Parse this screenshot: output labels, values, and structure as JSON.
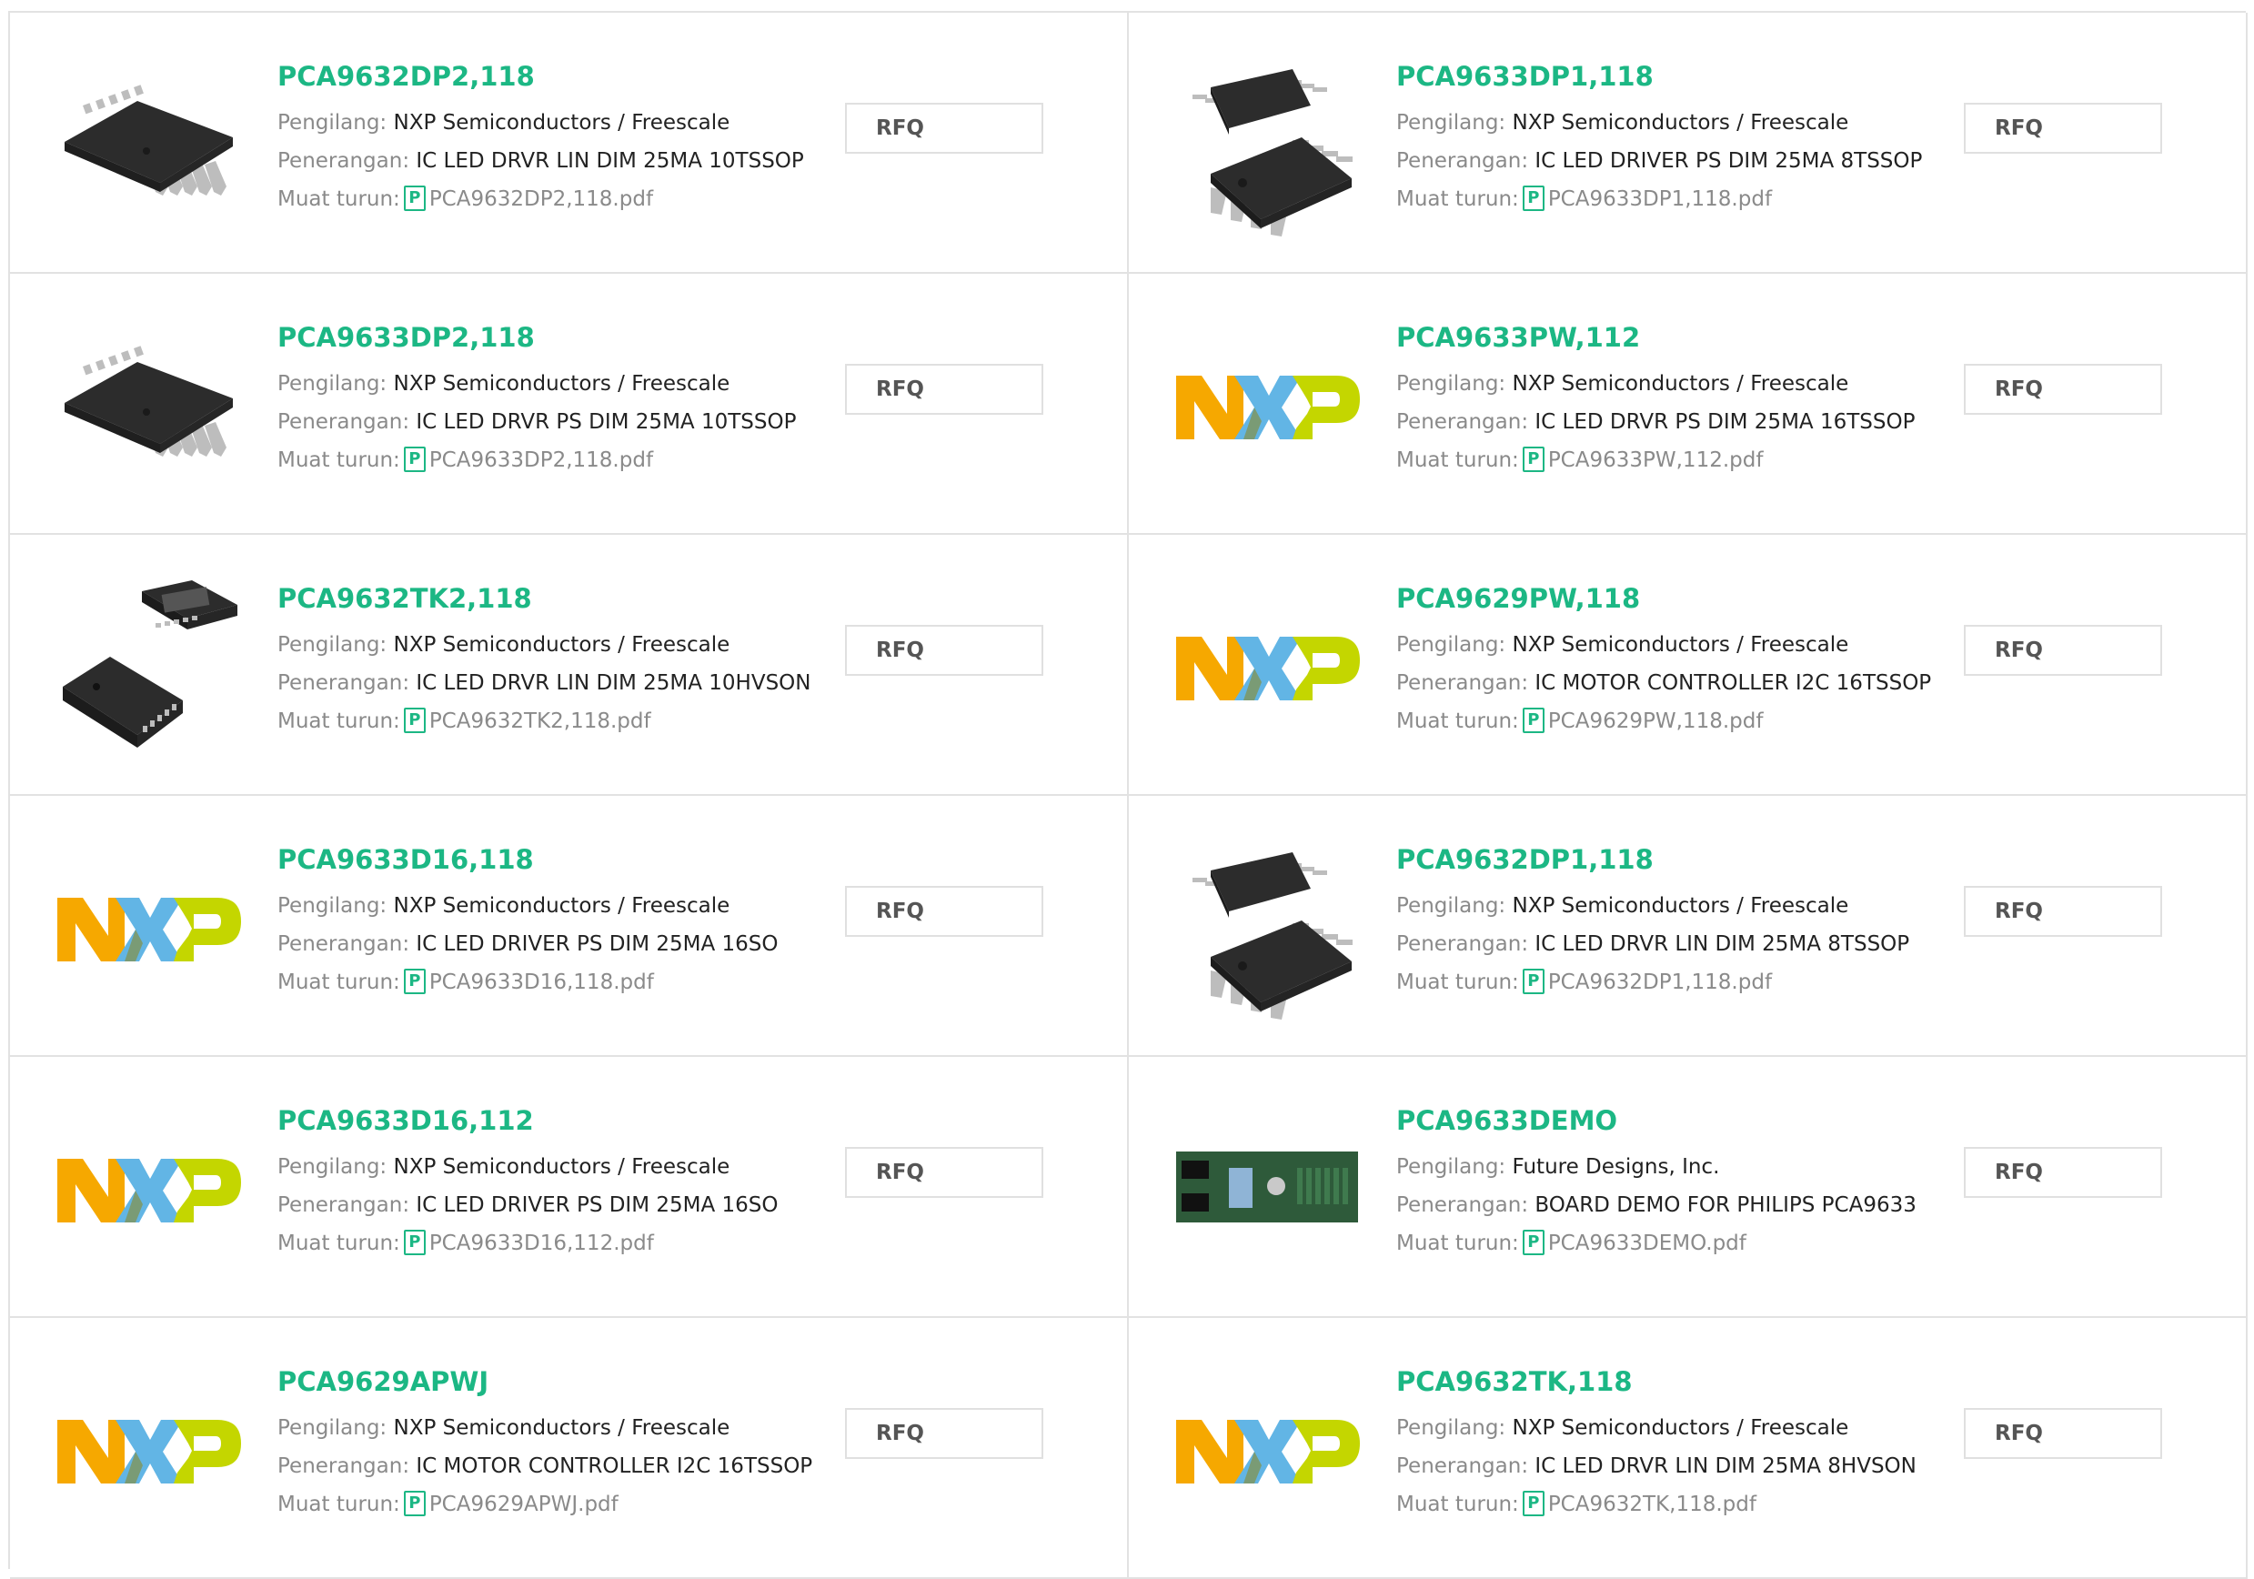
{
  "labels": {
    "manufacturer": "Pengilang:",
    "description": "Penerangan:",
    "download": "Muat turun:",
    "rfq": "RFQ",
    "pdf_glyph": "P"
  },
  "logo_letters": [
    "N",
    "X",
    "P"
  ],
  "colors": {
    "accent": "#1cb784",
    "border": "#e2e2e2",
    "nxp_orange": "#f6a800",
    "nxp_blue": "#62b5e5",
    "nxp_green": "#c4d600"
  },
  "products": [
    {
      "part": "PCA9632DP2,118",
      "manufacturer": "NXP Semiconductors / Freescale",
      "description": "IC LED DRVR LIN DIM 25MA 10TSSOP",
      "pdf": "PCA9632DP2,118.pdf",
      "image": "tssop10-chip"
    },
    {
      "part": "PCA9633DP1,118",
      "manufacturer": "NXP Semiconductors / Freescale",
      "description": "IC LED DRIVER PS DIM 25MA 8TSSOP",
      "pdf": "PCA9633DP1,118.pdf",
      "image": "tssop8-chips"
    },
    {
      "part": "PCA9633DP2,118",
      "manufacturer": "NXP Semiconductors / Freescale",
      "description": "IC LED DRVR PS DIM 25MA 10TSSOP",
      "pdf": "PCA9633DP2,118.pdf",
      "image": "tssop10-chip"
    },
    {
      "part": "PCA9633PW,112",
      "manufacturer": "NXP Semiconductors / Freescale",
      "description": "IC LED DRVR PS DIM 25MA 16TSSOP",
      "pdf": "PCA9633PW,112.pdf",
      "image": "nxp-logo"
    },
    {
      "part": "PCA9632TK2,118",
      "manufacturer": "NXP Semiconductors / Freescale",
      "description": "IC LED DRVR LIN DIM 25MA 10HVSON",
      "pdf": "PCA9632TK2,118.pdf",
      "image": "hvson-chips"
    },
    {
      "part": "PCA9629PW,118",
      "manufacturer": "NXP Semiconductors / Freescale",
      "description": "IC MOTOR CONTROLLER I2C 16TSSOP",
      "pdf": "PCA9629PW,118.pdf",
      "image": "nxp-logo"
    },
    {
      "part": "PCA9633D16,118",
      "manufacturer": "NXP Semiconductors / Freescale",
      "description": "IC LED DRIVER PS DIM 25MA 16SO",
      "pdf": "PCA9633D16,118.pdf",
      "image": "nxp-logo"
    },
    {
      "part": "PCA9632DP1,118",
      "manufacturer": "NXP Semiconductors / Freescale",
      "description": "IC LED DRVR LIN DIM 25MA 8TSSOP",
      "pdf": "PCA9632DP1,118.pdf",
      "image": "tssop8-chips"
    },
    {
      "part": "PCA9633D16,112",
      "manufacturer": "NXP Semiconductors / Freescale",
      "description": "IC LED DRIVER PS DIM 25MA 16SO",
      "pdf": "PCA9633D16,112.pdf",
      "image": "nxp-logo"
    },
    {
      "part": "PCA9633DEMO",
      "manufacturer": "Future Designs, Inc.",
      "description": "BOARD DEMO FOR PHILIPS PCA9633",
      "pdf": "PCA9633DEMO.pdf",
      "image": "demo-board"
    },
    {
      "part": "PCA9629APWJ",
      "manufacturer": "NXP Semiconductors / Freescale",
      "description": "IC MOTOR CONTROLLER I2C 16TSSOP",
      "pdf": "PCA9629APWJ.pdf",
      "image": "nxp-logo"
    },
    {
      "part": "PCA9632TK,118",
      "manufacturer": "NXP Semiconductors / Freescale",
      "description": "IC LED DRVR LIN DIM 25MA 8HVSON",
      "pdf": "PCA9632TK,118.pdf",
      "image": "nxp-logo"
    }
  ]
}
